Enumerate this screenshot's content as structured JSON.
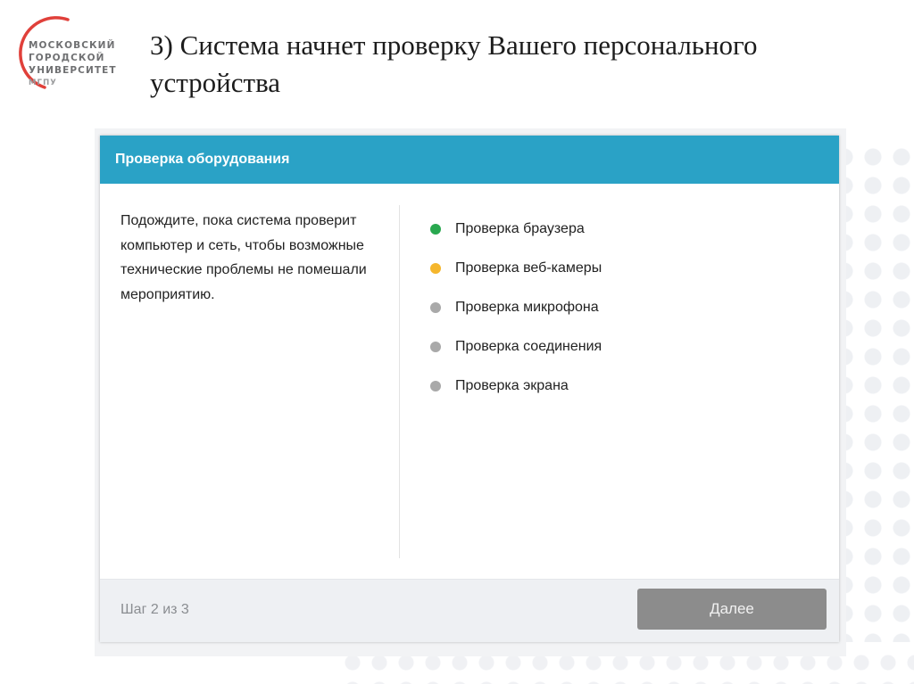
{
  "logo": {
    "lines": [
      "МОСКОВСКИЙ",
      "ГОРОДСКОЙ",
      "УНИВЕРСИТЕТ"
    ],
    "abbr": "МГПУ",
    "arc_color": "#e0403a"
  },
  "slide": {
    "title_line1": "3) Система начнет проверку Вашего персонального",
    "title_line2": "устройства"
  },
  "modal": {
    "header_title": "Проверка оборудования",
    "header_color": "#2aa2c6",
    "description": "Подождите, пока система проверит компьютер и сеть, чтобы возможные технические проблемы не помешали мероприятию.",
    "checks": [
      {
        "label": "Проверка браузера",
        "status_color": "#29a84f"
      },
      {
        "label": "Проверка веб-камеры",
        "status_color": "#f5b62c"
      },
      {
        "label": "Проверка микрофона",
        "status_color": "#a9a9a9"
      },
      {
        "label": "Проверка соединения",
        "status_color": "#a9a9a9"
      },
      {
        "label": "Проверка экрана",
        "status_color": "#a9a9a9"
      }
    ],
    "step_text": "Шаг 2 из 3",
    "next_label": "Далее"
  }
}
